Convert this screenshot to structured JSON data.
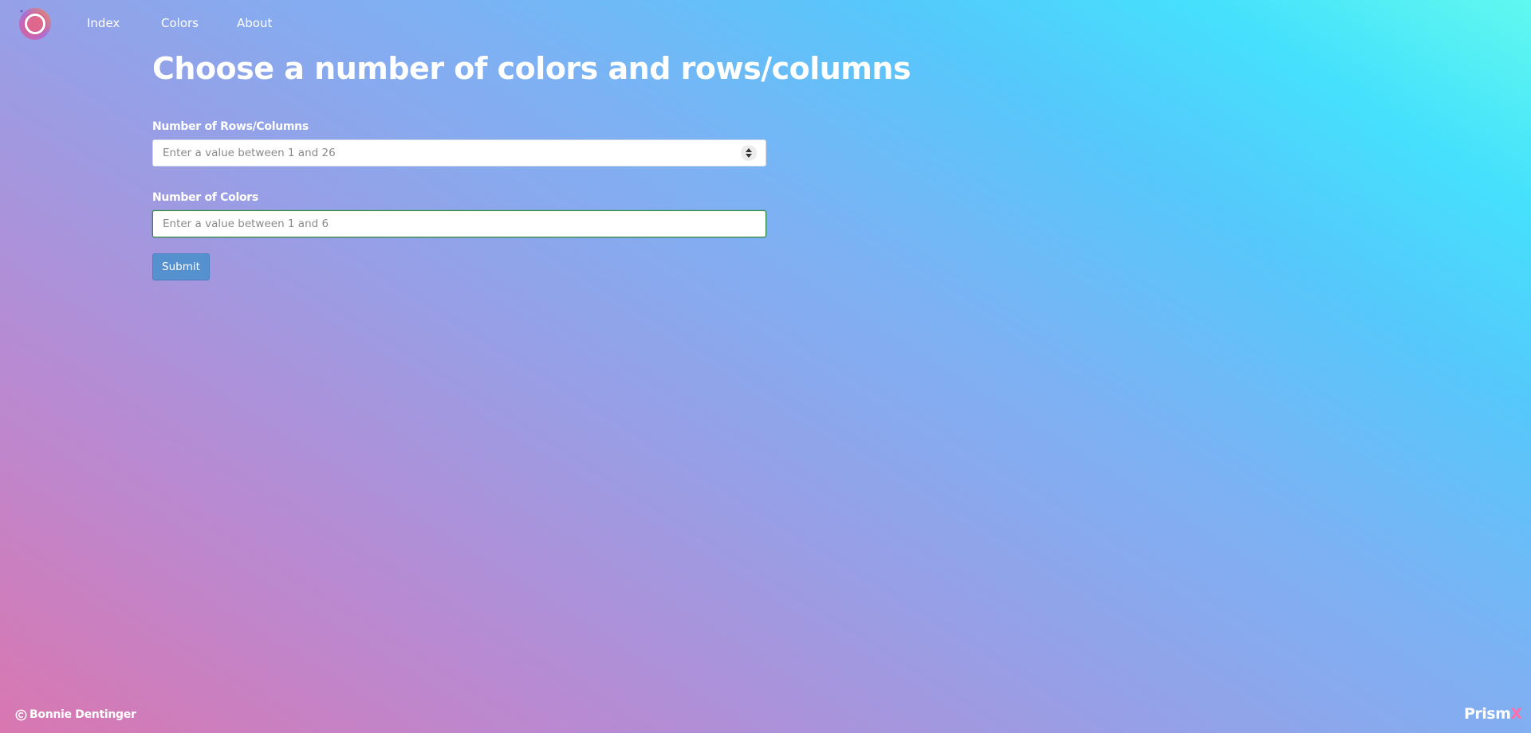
{
  "nav": {
    "logo_icon": "prism-circle-logo-icon",
    "links": [
      {
        "label": "Index"
      },
      {
        "label": "Colors"
      },
      {
        "label": "About"
      }
    ]
  },
  "main": {
    "title": "Choose a number of colors and rows/columns",
    "rows_field": {
      "label": "Number of Rows/Columns",
      "value": "",
      "placeholder": "Enter a value between 1 and 26"
    },
    "colors_field": {
      "label": "Number of Colors",
      "value": "",
      "placeholder": "Enter a value between 1 and 6"
    },
    "submit_label": "Submit"
  },
  "footer": {
    "copyright_icon": "copyright-icon",
    "author": "Bonnie Dentinger",
    "brand_main": "Prism",
    "brand_accent": "X"
  },
  "colors": {
    "gradient_start": "#d977b0",
    "gradient_end": "#60f9ef",
    "submit_bg": "#5590cf",
    "focus_border": "#2f8a3c",
    "brand_accent": "#ff6fa8"
  }
}
